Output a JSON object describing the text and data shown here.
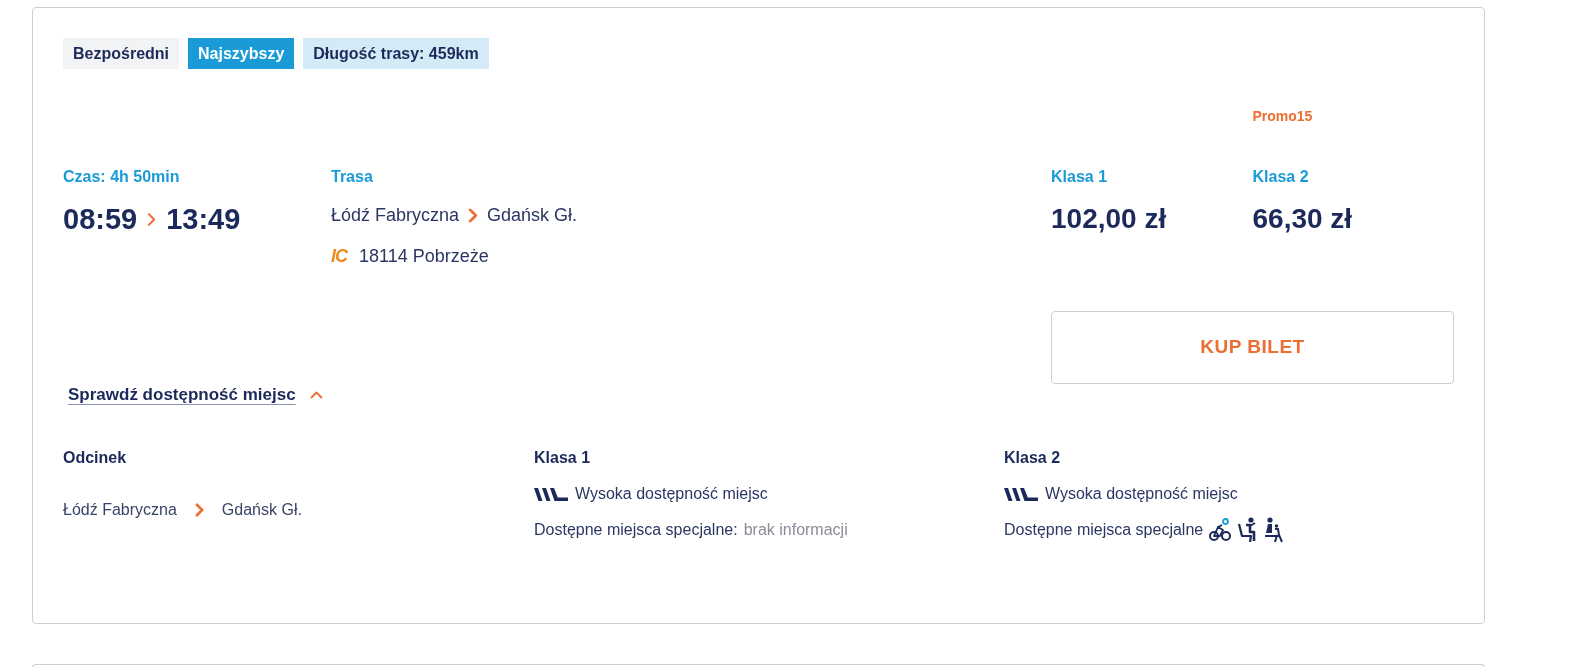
{
  "tags": [
    {
      "label": "Bezpośredni",
      "kind": "plain"
    },
    {
      "label": "Najszybszy",
      "kind": "highlight"
    },
    {
      "label": "Długość trasy: 459km",
      "kind": "info"
    }
  ],
  "journey": {
    "duration": "Czas: 4h 50min",
    "departure": "08:59",
    "arrival": "13:49"
  },
  "route": {
    "heading": "Trasa",
    "from": "Łódź Fabryczna",
    "to": "Gdańsk Gł.",
    "carrier_logo": "IC",
    "train": "18114 Pobrzeże"
  },
  "fares": [
    {
      "class_label": "Klasa 1",
      "price": "102,00 zł"
    },
    {
      "class_label": "Klasa 2",
      "price": "66,30 zł",
      "promo": "Promo15"
    }
  ],
  "buy_button": "KUP BILET",
  "availability": {
    "toggle": "Sprawdź dostępność miejsc",
    "expanded": true,
    "segment_heading": "Odcinek",
    "segment": {
      "from": "Łódź Fabryczna",
      "to": "Gdańsk Gł."
    },
    "classes": [
      {
        "heading": "Klasa 1",
        "status": "Wysoka dostępność miejsc",
        "special_label": "Dostępne miejsca specjalne:",
        "special_value": "brak informacji"
      },
      {
        "heading": "Klasa 2",
        "status": "Wysoka dostępność miejsc",
        "special_label": "Dostępne miejsca specjalne",
        "special_places": [
          {
            "kind": "bicycle"
          },
          {
            "kind": "seated"
          },
          {
            "kind": "child"
          }
        ]
      }
    ]
  }
}
